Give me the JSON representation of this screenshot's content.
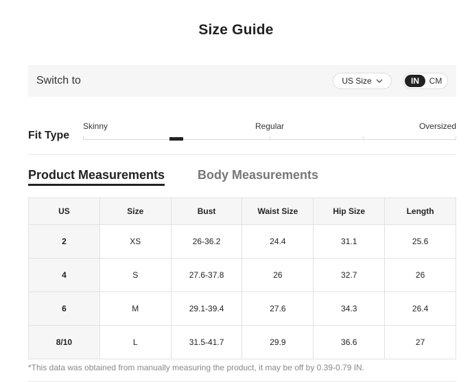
{
  "title": "Size Guide",
  "switch_bar": {
    "label": "Switch to",
    "size_select": "US Size",
    "units": [
      {
        "label": "IN",
        "active": true
      },
      {
        "label": "CM",
        "active": false
      }
    ]
  },
  "fit_type": {
    "label": "Fit Type",
    "scale_labels": [
      "Skinny",
      "Regular",
      "Oversized"
    ],
    "selected_level": 0.25
  },
  "tabs": [
    {
      "label": "Product Measurements",
      "active": true
    },
    {
      "label": "Body Measurements",
      "active": false
    }
  ],
  "table": {
    "headers": [
      "US",
      "Size",
      "Bust",
      "Waist Size",
      "Hip Size",
      "Length"
    ],
    "rows": [
      [
        "2",
        "XS",
        "26-36.2",
        "24.4",
        "31.1",
        "25.6"
      ],
      [
        "4",
        "S",
        "27.6-37.8",
        "26",
        "32.7",
        "26"
      ],
      [
        "6",
        "M",
        "29.1-39.4",
        "27.6",
        "34.3",
        "26.4"
      ],
      [
        "8/10",
        "L",
        "31.5-41.7",
        "29.9",
        "36.6",
        "27"
      ]
    ]
  },
  "footnote": "*This data was obtained from manually measuring the product, it may be off by 0.39-0.79 IN."
}
